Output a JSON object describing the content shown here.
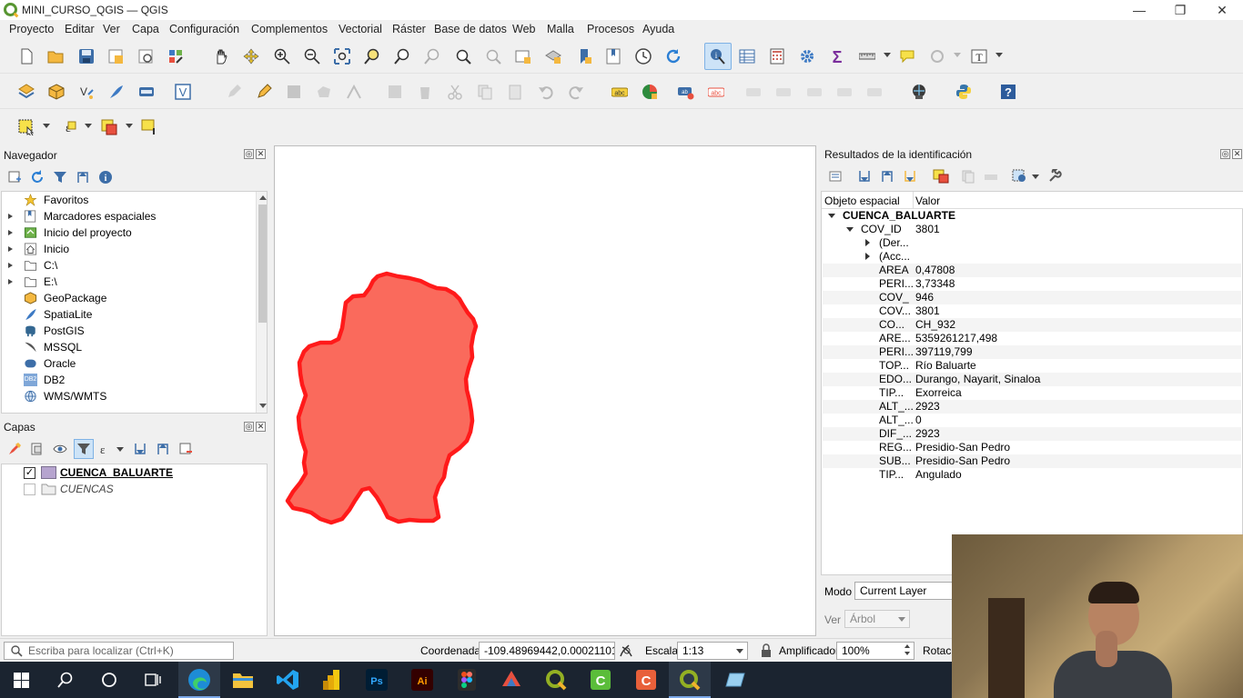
{
  "window": {
    "title": "MINI_CURSO_QGIS — QGIS",
    "minimize": "—",
    "restore": "❐",
    "close": "✕"
  },
  "menubar": [
    "Proyecto",
    "Editar",
    "Ver",
    "Capa",
    "Configuración",
    "Complementos",
    "Vectorial",
    "Ráster",
    "Base de datos",
    "Web",
    "Malla",
    "Procesos",
    "Ayuda"
  ],
  "browser": {
    "title": "Navegador",
    "items": [
      "Favoritos",
      "Marcadores espaciales",
      "Inicio del proyecto",
      "Inicio",
      "C:\\",
      "E:\\",
      "GeoPackage",
      "SpatiaLite",
      "PostGIS",
      "MSSQL",
      "Oracle",
      "DB2",
      "WMS/WMTS"
    ],
    "db2_badge": "DB2"
  },
  "layers": {
    "title": "Capas",
    "items": [
      {
        "name": "CUENCA_BALUARTE",
        "checked": true
      },
      {
        "name": "CUENCAS",
        "checked": false
      }
    ]
  },
  "identify": {
    "title": "Resultados de la identificación",
    "col_feature": "Objeto espacial",
    "col_value": "Valor",
    "layer": "CUENCA_BALUARTE",
    "feature_key": "COV_ID",
    "feature_val": "3801",
    "groups": [
      "(Der...",
      "(Acc..."
    ],
    "rows": [
      {
        "k": "AREA",
        "v": "0,47808"
      },
      {
        "k": "PERI...",
        "v": "3,73348"
      },
      {
        "k": "COV_",
        "v": "946"
      },
      {
        "k": "COV...",
        "v": "3801"
      },
      {
        "k": "CO...",
        "v": "CH_932"
      },
      {
        "k": "ARE...",
        "v": "5359261217,498"
      },
      {
        "k": "PERI...",
        "v": "397119,799"
      },
      {
        "k": "TOP...",
        "v": "Río Baluarte"
      },
      {
        "k": "EDO...",
        "v": "Durango, Nayarit, Sinaloa"
      },
      {
        "k": "TIP...",
        "v": "Exorreica"
      },
      {
        "k": "ALT_...",
        "v": "2923"
      },
      {
        "k": "ALT_...",
        "v": "0"
      },
      {
        "k": "DIF_...",
        "v": "2923"
      },
      {
        "k": "REG...",
        "v": "Presidio-San Pedro"
      },
      {
        "k": "SUB...",
        "v": "Presidio-San Pedro"
      },
      {
        "k": "TIP...",
        "v": "Angulado"
      }
    ],
    "mode_label": "Modo",
    "mode_value": "Current Layer",
    "view_label": "Ver",
    "view_value": "Árbol"
  },
  "statusbar": {
    "locator_placeholder": "Escriba para localizar (Ctrl+K)",
    "coord_label": "Coordenada",
    "coord_value": "-109.48969442,0.00021101",
    "scale_label": "Escala",
    "scale_value": "1:13",
    "magnifier_label": "Amplificador",
    "magnifier_value": "100%",
    "rotation_label": "Rotaci"
  },
  "colors": {
    "polygon_fill": "#fa6a5c",
    "polygon_stroke": "#ff1a1a",
    "qgis_green": "#589632"
  }
}
